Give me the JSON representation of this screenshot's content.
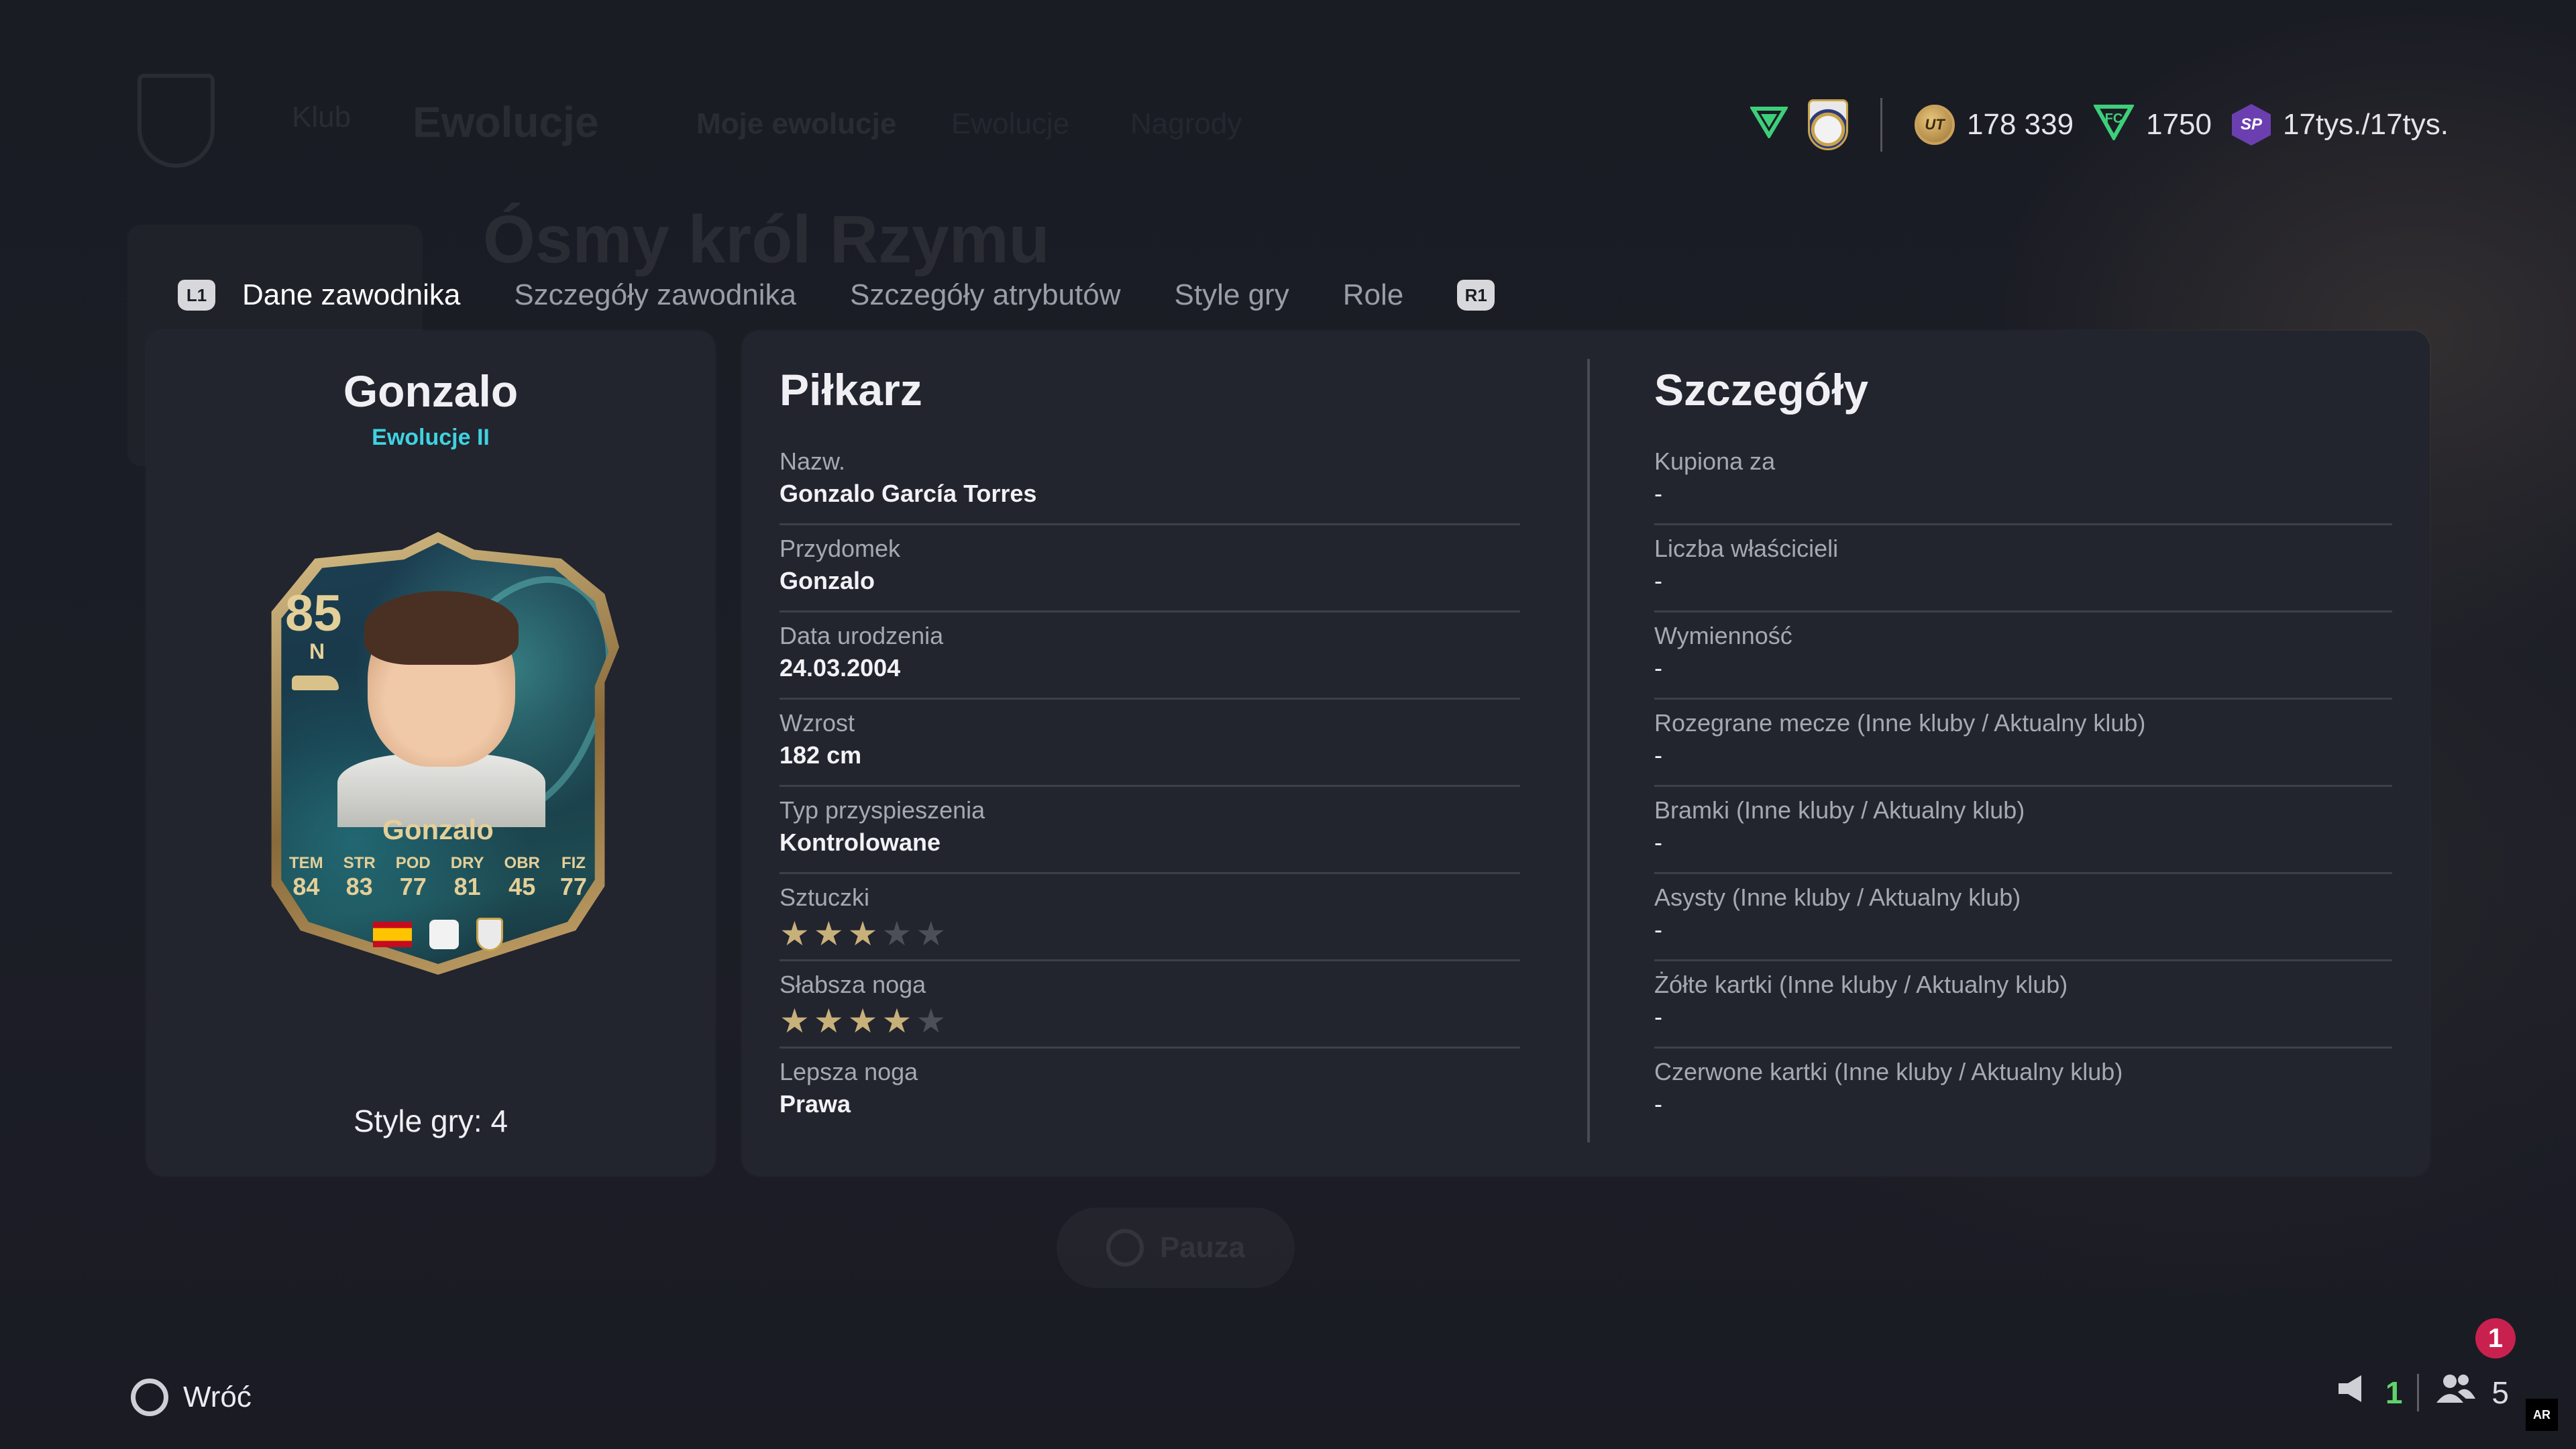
{
  "background": {
    "club_label": "Klub",
    "section_title": "Ewolucje",
    "tab_mine": "Moje ewolucje",
    "tab_2": "Ewolucje",
    "tab_3": "Nagrody",
    "evo_title": "Ósmy król Rzymu",
    "pause_label": "Pauza"
  },
  "currency": {
    "coins": "178 339",
    "points": "1750",
    "sp": "17tys./17tys.",
    "icons": [
      "shield-green-icon",
      "club-crest-icon",
      "coin-icon",
      "fc-points-icon",
      "sp-icon"
    ]
  },
  "tabs": {
    "l1": "L1",
    "r1": "R1",
    "items": [
      "Dane zawodnika",
      "Szczegóły zawodnika",
      "Szczegóły atrybutów",
      "Style gry",
      "Role"
    ],
    "active_index": 0
  },
  "player": {
    "name": "Gonzalo",
    "subtitle": "Ewolucje II",
    "styles_label": "Style gry: 4",
    "card": {
      "rating": "85",
      "position": "N",
      "name": "Gonzalo",
      "stats": [
        {
          "label": "TEM",
          "value": "84"
        },
        {
          "label": "STR",
          "value": "83"
        },
        {
          "label": "POD",
          "value": "77"
        },
        {
          "label": "DRY",
          "value": "81"
        },
        {
          "label": "OBR",
          "value": "45"
        },
        {
          "label": "FIZ",
          "value": "77"
        }
      ]
    }
  },
  "pilkarz": {
    "title": "Piłkarz",
    "rows": [
      {
        "label": "Nazw.",
        "value": "Gonzalo García Torres"
      },
      {
        "label": "Przydomek",
        "value": "Gonzalo"
      },
      {
        "label": "Data urodzenia",
        "value": "24.03.2004"
      },
      {
        "label": "Wzrost",
        "value": "182 cm"
      },
      {
        "label": "Typ przyspieszenia",
        "value": "Kontrolowane"
      }
    ],
    "skill_moves": {
      "label": "Sztuczki",
      "stars": 3,
      "max": 5
    },
    "weak_foot": {
      "label": "Słabsza noga",
      "stars": 4,
      "max": 5
    },
    "preferred_foot": {
      "label": "Lepsza noga",
      "value": "Prawa"
    }
  },
  "szczegoly": {
    "title": "Szczegóły",
    "rows": [
      {
        "label": "Kupiona za",
        "value": "-"
      },
      {
        "label": "Liczba właścicieli",
        "value": "-"
      },
      {
        "label": "Wymienność",
        "value": "-"
      },
      {
        "label": "Rozegrane mecze (Inne kluby / Aktualny klub)",
        "value": "-"
      },
      {
        "label": "Bramki (Inne kluby / Aktualny klub)",
        "value": "-"
      },
      {
        "label": "Asysty (Inne kluby / Aktualny klub)",
        "value": "-"
      },
      {
        "label": "Żółte kartki (Inne kluby / Aktualny klub)",
        "value": "-"
      },
      {
        "label": "Czerwone kartki (Inne kluby / Aktualny klub)",
        "value": "-"
      }
    ]
  },
  "footer": {
    "back_label": "Wróć",
    "messages_count": "1",
    "friends_count": "5",
    "notification_count": "1",
    "corner_logo": "AR"
  }
}
